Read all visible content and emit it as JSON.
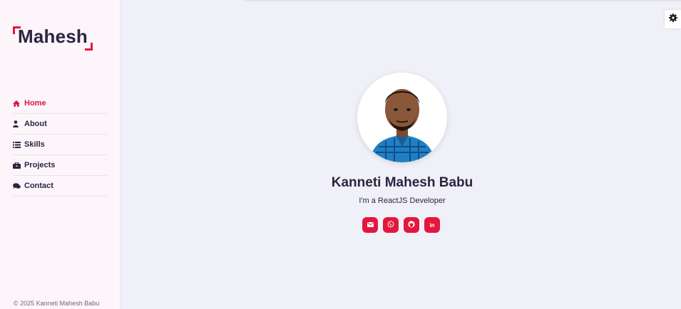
{
  "brand": {
    "logo_text": "Mahesh",
    "accent": "#e3173e"
  },
  "nav": {
    "items": [
      {
        "label": "Home",
        "icon": "home-icon",
        "active": true
      },
      {
        "label": "About",
        "icon": "user-icon",
        "active": false
      },
      {
        "label": "Skills",
        "icon": "list-icon",
        "active": false
      },
      {
        "label": "Projects",
        "icon": "briefcase-icon",
        "active": false
      },
      {
        "label": "Contact",
        "icon": "comments-icon",
        "active": false
      }
    ]
  },
  "footer": {
    "copyright": "© 2025 Kanneti Mahesh Babu"
  },
  "profile": {
    "name": "Kanneti Mahesh Babu",
    "tagline": "I'm a ReactJS Developer",
    "socials": [
      {
        "icon": "envelope-icon"
      },
      {
        "icon": "whatsapp-icon"
      },
      {
        "icon": "github-icon"
      },
      {
        "label": "in",
        "icon": "linkedin-icon"
      }
    ]
  },
  "settings": {
    "icon": "gear-icon"
  }
}
